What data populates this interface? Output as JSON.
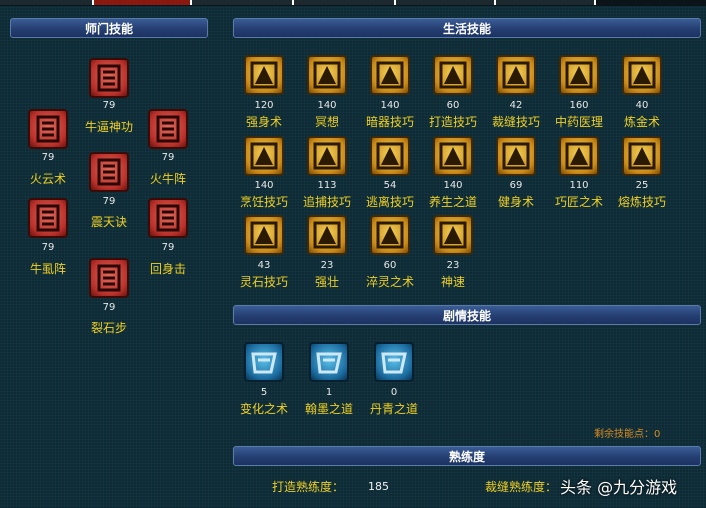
{
  "headers": {
    "sect": "师门技能",
    "life": "生活技能",
    "story": "剧情技能",
    "proficiency": "熟练度"
  },
  "sect_skills": [
    {
      "name": "牛逼神功",
      "level": "79",
      "icon": "demon-mask-icon"
    },
    {
      "name": "火云术",
      "level": "79",
      "icon": "fire-cloud-icon"
    },
    {
      "name": "火牛阵",
      "level": "79",
      "icon": "fire-bull-icon"
    },
    {
      "name": "震天诀",
      "level": "79",
      "icon": "thunder-icon"
    },
    {
      "name": "牛虱阵",
      "level": "79",
      "icon": "beetle-icon"
    },
    {
      "name": "回身击",
      "level": "79",
      "icon": "skull-icon"
    },
    {
      "name": "裂石步",
      "level": "79",
      "icon": "stone-step-icon"
    }
  ],
  "life_skills": [
    {
      "name": "强身术",
      "level": "120",
      "icon": "strength-icon"
    },
    {
      "name": "冥想",
      "level": "140",
      "icon": "meditation-icon"
    },
    {
      "name": "暗器技巧",
      "level": "140",
      "icon": "dart-icon"
    },
    {
      "name": "打造技巧",
      "level": "60",
      "icon": "forge-icon"
    },
    {
      "name": "裁缝技巧",
      "level": "42",
      "icon": "scissors-icon"
    },
    {
      "name": "中药医理",
      "level": "160",
      "icon": "herb-icon"
    },
    {
      "name": "炼金术",
      "level": "40",
      "icon": "alchemy-icon"
    },
    {
      "name": "烹饪技巧",
      "level": "140",
      "icon": "cooking-icon"
    },
    {
      "name": "追捕技巧",
      "level": "113",
      "icon": "chain-icon"
    },
    {
      "name": "逃离技巧",
      "level": "54",
      "icon": "escape-icon"
    },
    {
      "name": "养生之道",
      "level": "140",
      "icon": "health-icon"
    },
    {
      "name": "健身术",
      "level": "69",
      "icon": "fitness-icon"
    },
    {
      "name": "巧匠之术",
      "level": "110",
      "icon": "craftsman-icon"
    },
    {
      "name": "熔炼技巧",
      "level": "25",
      "icon": "smelting-icon"
    },
    {
      "name": "灵石技巧",
      "level": "43",
      "icon": "gem-icon"
    },
    {
      "name": "强壮",
      "level": "23",
      "icon": "muscle-icon"
    },
    {
      "name": "淬灵之术",
      "level": "60",
      "icon": "temper-icon"
    },
    {
      "name": "神速",
      "level": "23",
      "icon": "speed-icon"
    }
  ],
  "story_skills": [
    {
      "name": "变化之术",
      "level": "5",
      "icon": "transform-icon"
    },
    {
      "name": "翰墨之道",
      "level": "1",
      "icon": "ink-brush-icon"
    },
    {
      "name": "丹青之道",
      "level": "0",
      "icon": "scroll-painting-icon"
    }
  ],
  "remaining_points": "剩余技能点：0",
  "proficiency": {
    "forge_label": "打造熟练度：",
    "forge_value": "185",
    "tailor_label": "裁缝熟练度："
  },
  "watermark": "头条 @九分游戏"
}
